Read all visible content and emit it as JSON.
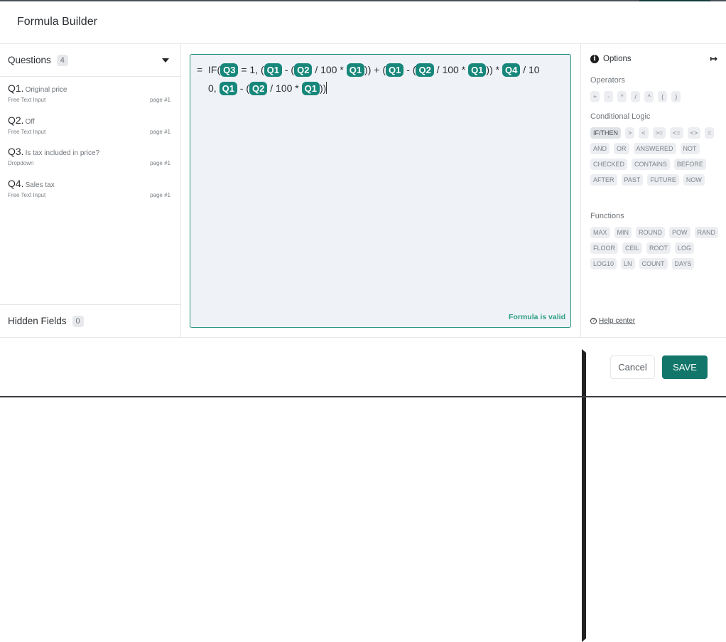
{
  "dialog": {
    "title": "Formula Builder"
  },
  "questions": {
    "label": "Questions",
    "count": "4",
    "items": [
      {
        "num": "Q1.",
        "name": "Original price",
        "type": "Free Text Input",
        "page": "page #1"
      },
      {
        "num": "Q2.",
        "name": "Off",
        "type": "Free Text Input",
        "page": "page #1"
      },
      {
        "num": "Q3.",
        "name": "Is tax included in price?",
        "type": "Dropdown",
        "page": "page #1"
      },
      {
        "num": "Q4.",
        "name": "Sales tax",
        "type": "Free Text Input",
        "page": "page #1"
      }
    ]
  },
  "hidden_fields": {
    "label": "Hidden Fields",
    "count": "0"
  },
  "editor": {
    "equals": "=",
    "line1": [
      {
        "t": "text",
        "v": "IF("
      },
      {
        "t": "chip",
        "v": "Q3"
      },
      {
        "t": "text",
        "v": " = 1, ("
      },
      {
        "t": "chip",
        "v": "Q1"
      },
      {
        "t": "text",
        "v": " - ("
      },
      {
        "t": "chip",
        "v": "Q2"
      },
      {
        "t": "text",
        "v": " / 100 * "
      },
      {
        "t": "chip",
        "v": "Q1"
      },
      {
        "t": "text",
        "v": ")) + ("
      },
      {
        "t": "chip",
        "v": "Q1"
      },
      {
        "t": "text",
        "v": " - ("
      },
      {
        "t": "chip",
        "v": "Q2"
      },
      {
        "t": "text",
        "v": " / 100 * "
      },
      {
        "t": "chip",
        "v": "Q1"
      },
      {
        "t": "text",
        "v": ")) * "
      },
      {
        "t": "chip",
        "v": "Q4"
      },
      {
        "t": "text",
        "v": " / 10"
      }
    ],
    "line2": [
      {
        "t": "text",
        "v": "0, "
      },
      {
        "t": "chip",
        "v": "Q1"
      },
      {
        "t": "text",
        "v": " - ("
      },
      {
        "t": "chip",
        "v": "Q2"
      },
      {
        "t": "text",
        "v": " / 100 * "
      },
      {
        "t": "chip",
        "v": "Q1"
      },
      {
        "t": "text",
        "v": "))"
      }
    ],
    "status": "Formula is valid"
  },
  "options": {
    "title": "Options",
    "operators": {
      "title": "Operators",
      "items": [
        "+",
        "-",
        "*",
        "/",
        "^",
        "(",
        ")"
      ]
    },
    "conditional": {
      "title": "Conditional Logic",
      "items": [
        "IF/THEN",
        ">",
        "<",
        ">=",
        "<=",
        "<>",
        "=",
        "AND",
        "OR",
        "ANSWERED",
        "NOT",
        "CHECKED",
        "CONTAINS",
        "BEFORE",
        "AFTER",
        "PAST",
        "FUTURE",
        "NOW"
      ]
    },
    "functions": {
      "title": "Functions",
      "items": [
        "MAX",
        "MIN",
        "ROUND",
        "POW",
        "RAND",
        "FLOOR",
        "CEIL",
        "ROOT",
        "LOG",
        "LOG10",
        "LN",
        "COUNT",
        "DAYS"
      ]
    },
    "help": "Help center"
  },
  "footer": {
    "cancel": "Cancel",
    "save": "SAVE"
  },
  "colors": {
    "accent": "#13766a",
    "chip": "#16877a",
    "valid": "#2e9e87"
  }
}
